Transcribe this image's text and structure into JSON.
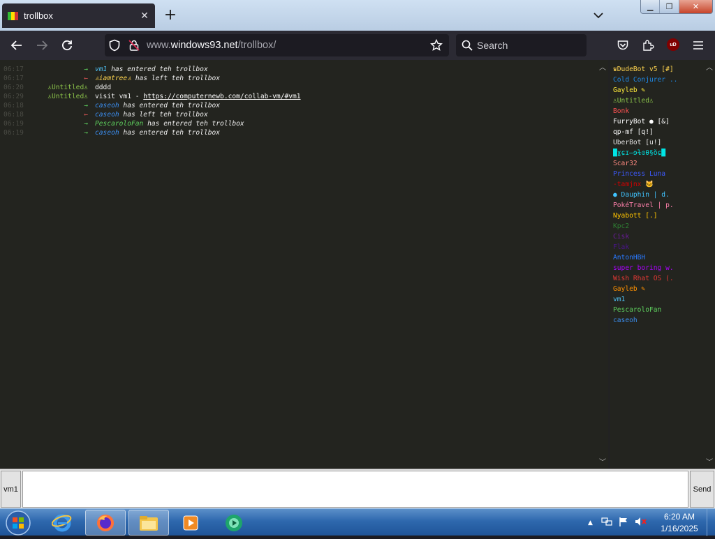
{
  "browser": {
    "tab_title": "trollbox",
    "url_domain_prefix": "www.",
    "url_domain": "windows93.net",
    "url_path": "/trollbox/",
    "search_placeholder": "Search",
    "ublock_label": "uD"
  },
  "chat": {
    "messages": [
      {
        "time": "06:17",
        "arrow": "→",
        "type": "in",
        "nick": "vm1",
        "text": " has entered teh trollbox",
        "color": "#4fc3f7"
      },
      {
        "time": "06:17",
        "arrow": "←",
        "type": "out",
        "nick": "♙iamtree♙",
        "text": " has left teh trollbox",
        "color": "#ffd54f"
      },
      {
        "time": "06:20",
        "nick_col": "♙Untitled♙",
        "text": "dddd",
        "type": "chat",
        "color": "#8bc34a"
      },
      {
        "time": "06:29",
        "nick_col": "♙Untitled♙",
        "text": "visit vm1 - ",
        "link": "https://computernewb.com/collab-vm/#vm1",
        "type": "chat",
        "color": "#8bc34a"
      },
      {
        "time": "06:18",
        "arrow": "→",
        "type": "in",
        "nick": "caseoh",
        "text": " has entered teh trollbox",
        "color": "#3b8ef0"
      },
      {
        "time": "06:18",
        "arrow": "←",
        "type": "out",
        "nick": "caseoh",
        "text": " has left teh trollbox",
        "color": "#3b8ef0"
      },
      {
        "time": "06:19",
        "arrow": "→",
        "type": "in",
        "nick": "PescaroloFan",
        "text": " has entered teh trollbox",
        "color": "#5fd35f"
      },
      {
        "time": "06:19",
        "arrow": "→",
        "type": "in",
        "nick": "caseoh",
        "text": " has entered teh trollbox",
        "color": "#3b8ef0"
      }
    ]
  },
  "users": [
    {
      "name": "♛DudeBot v5 [#]",
      "color": "#ffd54f"
    },
    {
      "name": "Cold Conjurer ..",
      "color": "#1e88e5"
    },
    {
      "name": "Gayleb ✎",
      "color": "#ffeb3b"
    },
    {
      "name": "♙Untitled♙",
      "color": "#8bc34a"
    },
    {
      "name": "Bonk",
      "color": "#ff5252"
    },
    {
      "name": "FurryBot ● [&]",
      "color": "#ffffff"
    },
    {
      "name": "qp-mf [q!]",
      "color": "#ffffff"
    },
    {
      "name": "UberBot [u!]",
      "color": "#e0e0e0"
    },
    {
      "name": "█ɣɕɪ̶ɘɫɞθ§ŏɕ█",
      "color": "#00e5e5"
    },
    {
      "name": "Scar32",
      "color": "#ff8a80"
    },
    {
      "name": "Princess Luna",
      "color": "#3d5afe"
    },
    {
      "name": "-tamjnx 🐱",
      "color": "#d50000"
    },
    {
      "name": "● Dauphin | d.",
      "color": "#40c4ff"
    },
    {
      "name": "PokéTravel | p.",
      "color": "#ff80ab"
    },
    {
      "name": "Nyabott [.]",
      "color": "#ffc400"
    },
    {
      "name": "Kpc2",
      "color": "#2e7d32"
    },
    {
      "name": "Cisk",
      "color": "#6a1b9a"
    },
    {
      "name": "Flak",
      "color": "#4a148c"
    },
    {
      "name": "AntonHBH",
      "color": "#2979ff"
    },
    {
      "name": "super boring w.",
      "color": "#aa00ff"
    },
    {
      "name": "Wish Rhat OS (.",
      "color": "#e53935"
    },
    {
      "name": "Gayleb ✎",
      "color": "#ff9100"
    },
    {
      "name": "vm1",
      "color": "#4fc3f7"
    },
    {
      "name": "PescaroloFan",
      "color": "#5fd35f"
    },
    {
      "name": "caseoh",
      "color": "#3b8ef0"
    }
  ],
  "input": {
    "nick_label": "vm1",
    "message_value": "",
    "send_label": "Send"
  },
  "taskbar": {
    "time": "6:20 AM",
    "date": "1/16/2025"
  }
}
